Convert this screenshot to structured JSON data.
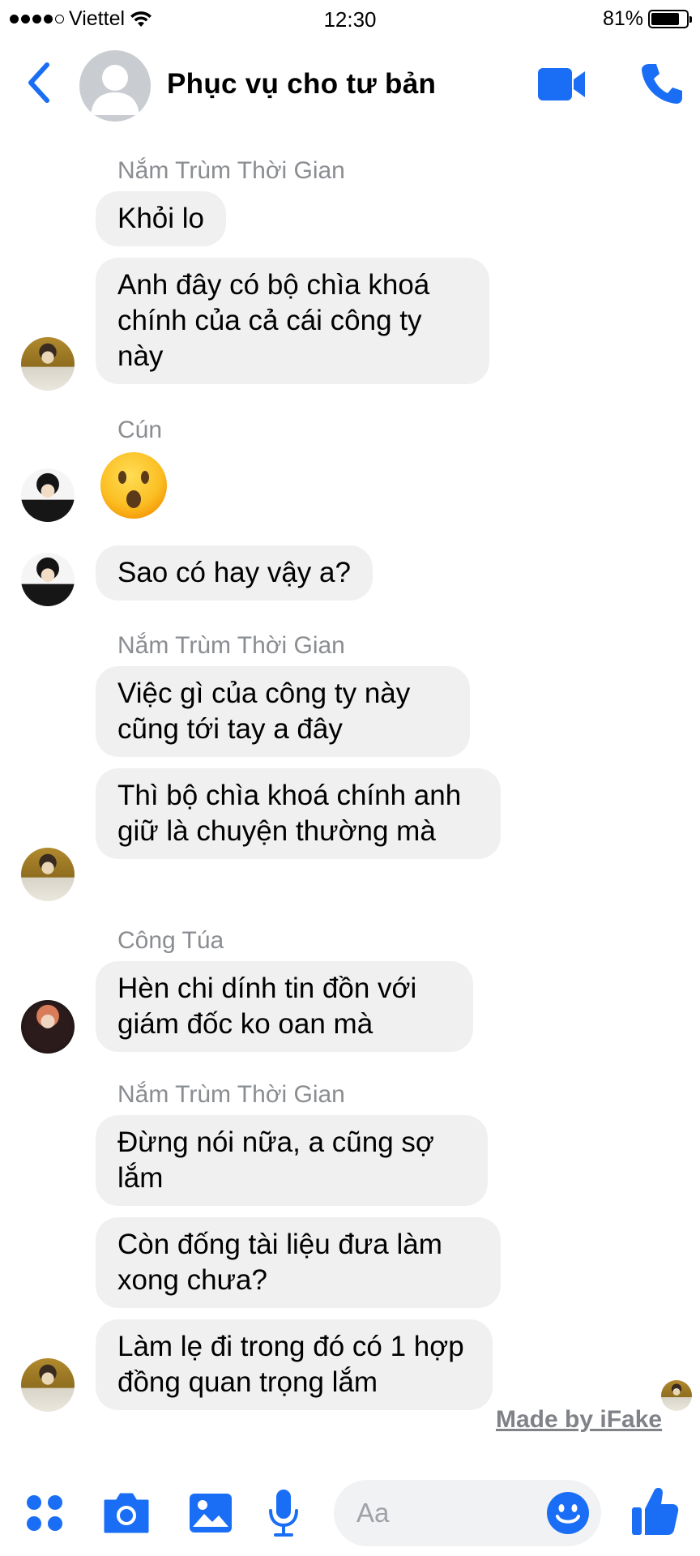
{
  "status_bar": {
    "carrier": "Viettel",
    "time": "12:30",
    "battery": "81%"
  },
  "header": {
    "title": "Phục vụ cho tư bản"
  },
  "messages": [
    {
      "sender": "Nắm Trùm Thời Gian",
      "bubbles": [
        "Khỏi lo",
        "Anh đây có bộ chìa khoá chính của cả cái công ty này"
      ]
    },
    {
      "sender": "Cún",
      "bubbles": [
        "😮",
        "Sao có hay vậy a?"
      ]
    },
    {
      "sender": "Nắm Trùm Thời Gian",
      "bubbles": [
        "Việc gì của công ty này cũng tới tay a đây",
        "Thì bộ chìa khoá chính anh giữ là chuyện thường mà"
      ]
    },
    {
      "sender": "Công Túa",
      "bubbles": [
        "Hèn chi dính tin đồn với giám đốc ko oan mà"
      ]
    },
    {
      "sender": "Nắm Trùm Thời Gian",
      "bubbles": [
        "Đừng nói nữa, a cũng sợ lắm",
        "Còn đống tài liệu đưa làm xong chưa?",
        "Làm lẹ đi trong đó có 1 hợp đồng quan trọng lắm"
      ]
    }
  ],
  "watermark": "Made by iFake",
  "composer": {
    "placeholder": "Aa"
  },
  "colors": {
    "accent": "#1a6ef5",
    "bubble": "#f0f0f0",
    "sender_name": "#8a8d91"
  }
}
